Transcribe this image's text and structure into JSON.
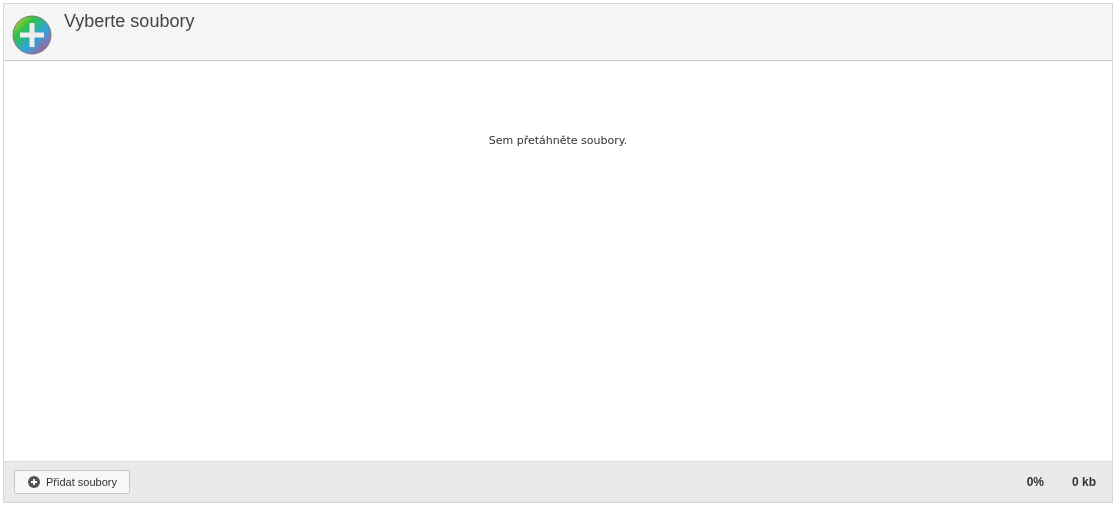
{
  "header": {
    "title": "Vyberte soubory"
  },
  "drop_zone": {
    "message": "Sem přetáhněte soubory."
  },
  "footer": {
    "add_button": "Přidat soubory",
    "progress": "0%",
    "size": "0 kb"
  }
}
